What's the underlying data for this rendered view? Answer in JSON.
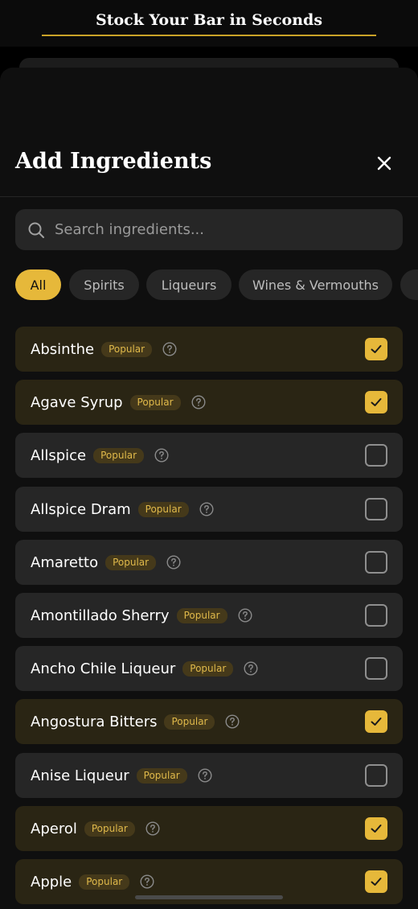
{
  "header": {
    "title": "Stock Your Bar in Seconds",
    "accent": "#c9a227"
  },
  "sheet": {
    "title": "Add Ingredients",
    "close_icon": "close-icon"
  },
  "search": {
    "placeholder": "Search ingredients...",
    "value": "",
    "icon": "search-icon"
  },
  "filters": [
    {
      "label": "All",
      "active": true
    },
    {
      "label": "Spirits",
      "active": false
    },
    {
      "label": "Liqueurs",
      "active": false
    },
    {
      "label": "Wines & Vermouths",
      "active": false
    }
  ],
  "ingredients": [
    {
      "name": "Absinthe",
      "badge": "Popular",
      "checked": true
    },
    {
      "name": "Agave Syrup",
      "badge": "Popular",
      "checked": true
    },
    {
      "name": "Allspice",
      "badge": "Popular",
      "checked": false
    },
    {
      "name": "Allspice Dram",
      "badge": "Popular",
      "checked": false
    },
    {
      "name": "Amaretto",
      "badge": "Popular",
      "checked": false
    },
    {
      "name": "Amontillado Sherry",
      "badge": "Popular",
      "checked": false
    },
    {
      "name": "Ancho Chile Liqueur",
      "badge": "Popular",
      "checked": false
    },
    {
      "name": "Angostura Bitters",
      "badge": "Popular",
      "checked": true
    },
    {
      "name": "Anise Liqueur",
      "badge": "Popular",
      "checked": false
    },
    {
      "name": "Aperol",
      "badge": "Popular",
      "checked": true
    },
    {
      "name": "Apple",
      "badge": "Popular",
      "checked": true
    }
  ],
  "colors": {
    "accent": "#e6b83a",
    "row": "#262626",
    "row_checked": "#2a2514",
    "badge_bg": "#45391a",
    "badge_text": "#e0b94a"
  }
}
